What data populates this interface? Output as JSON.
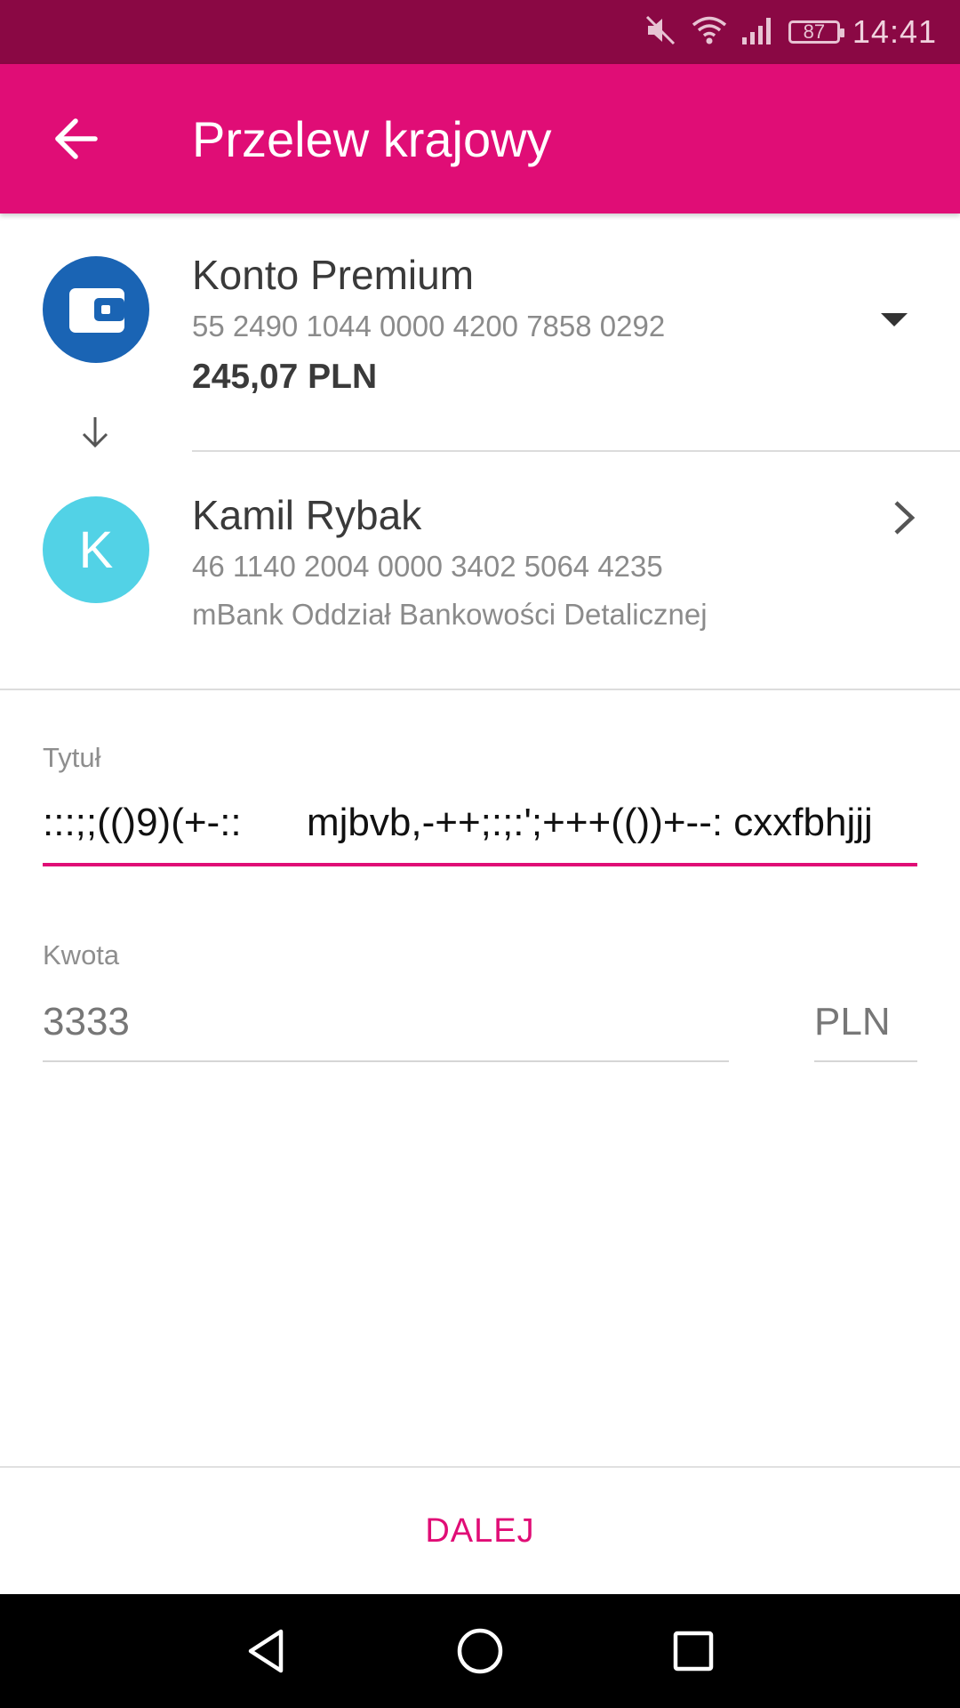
{
  "status_bar": {
    "time": "14:41",
    "battery": "87",
    "icons": [
      "mute-icon",
      "wifi-icon",
      "signal-icon",
      "battery-icon"
    ]
  },
  "app_bar": {
    "title": "Przelew krajowy",
    "back_icon": "arrow-left-icon"
  },
  "source_account": {
    "name": "Konto Premium",
    "number": "55 2490 1044 0000 4200 7858 0292",
    "balance": "245,07 PLN",
    "icon": "wallet-icon",
    "dropdown_icon": "caret-down-icon"
  },
  "recipient": {
    "initial": "K",
    "name": "Kamil Rybak",
    "number": "46 1140 2004 0000 3402 5064 4235",
    "bank": "mBank Oddział Bankowości Detalicznej",
    "chevron_icon": "chevron-right-icon"
  },
  "form": {
    "title_label": "Tytuł",
    "title_value": ":::;;(()9)(+-::      mjbvb,-++;:;:';+++(())+--: cxxfbhjjj",
    "amount_label": "Kwota",
    "amount_value": "3333",
    "currency": "PLN"
  },
  "next_button": "DALEJ",
  "colors": {
    "status_bar": "#8a0844",
    "primary": "#e00d76",
    "source_avatar": "#1a64b4",
    "recipient_avatar": "#52d2e6"
  },
  "nav_bar": {
    "icons": [
      "back-triangle-icon",
      "home-circle-icon",
      "recents-square-icon"
    ]
  }
}
